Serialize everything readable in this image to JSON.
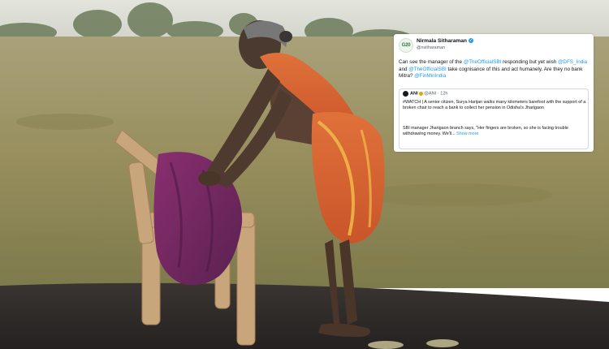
{
  "tweet": {
    "avatar_text": "G20",
    "author_name": "Nirmala Sitharaman",
    "author_handle": "@nsitharaman",
    "text_segments": [
      {
        "text": "Can see the manager of the ",
        "type": "plain"
      },
      {
        "text": "@TheOfficialSBI",
        "type": "mention"
      },
      {
        "text": " responding but yet wish ",
        "type": "plain"
      },
      {
        "text": "@DFS_India",
        "type": "mention"
      },
      {
        "text": " and ",
        "type": "plain"
      },
      {
        "text": "@TheOfficialSBI",
        "type": "mention"
      },
      {
        "text": " take cognisance of this and act humanely. Are they no bank Mitra? ",
        "type": "plain"
      },
      {
        "text": "@FinMinIndia",
        "type": "mention"
      }
    ],
    "quote": {
      "author_name": "ANI",
      "author_handle": "@ANI",
      "time": "12h",
      "text": "#WATCH | A senior citizen, Surya Harijan walks many kilometers barefoot with the support of a broken chair to reach a bank to collect her pension in Odisha's Jharigaon",
      "text2": "SBI manager Jharigaon branch says, \"Her fingers are broken, so she is facing trouble withdrawing money. We'll...",
      "show_more": "Show more"
    }
  },
  "colors": {
    "sky": "#d6d7cf",
    "field": "#9b9160",
    "road": "#2f2b28",
    "saree": "#d8642e",
    "chair": "#c9a57c",
    "cloth": "#7b2b63",
    "mention": "#1d9bf0"
  }
}
